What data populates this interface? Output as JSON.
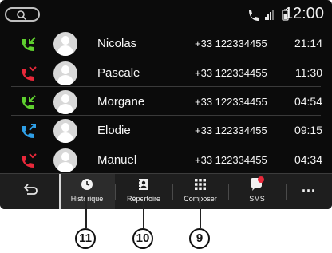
{
  "status_bar": {
    "clock": "12:00",
    "icons": [
      "search-icon",
      "phone-icon",
      "signal-icon",
      "battery-icon"
    ]
  },
  "calls": [
    {
      "type": "incoming",
      "type_color": "#5fcf2f",
      "name": "Nicolas",
      "number": "+33 122334455",
      "time": "21:14"
    },
    {
      "type": "missed",
      "type_color": "#e8283a",
      "name": "Pascale",
      "number": "+33 122334455",
      "time": "11:30"
    },
    {
      "type": "incoming",
      "type_color": "#5fcf2f",
      "name": "Morgane",
      "number": "+33 122334455",
      "time": "04:54"
    },
    {
      "type": "outgoing",
      "type_color": "#2f9fe6",
      "name": "Elodie",
      "number": "+33 122334455",
      "time": "09:15"
    },
    {
      "type": "missed",
      "type_color": "#e8283a",
      "name": "Manuel",
      "number": "+33 122334455",
      "time": "04:34"
    }
  ],
  "bottom_bar": {
    "historique_label": "Historique",
    "repertoire_label": "Répertoire",
    "composer_label": "Composer",
    "sms_label": "SMS",
    "more_label": "...",
    "active_tab": "Historique",
    "sms_badge_color": "#e8283a"
  },
  "callouts": {
    "historique": "11",
    "repertoire": "10",
    "composer": "9"
  }
}
